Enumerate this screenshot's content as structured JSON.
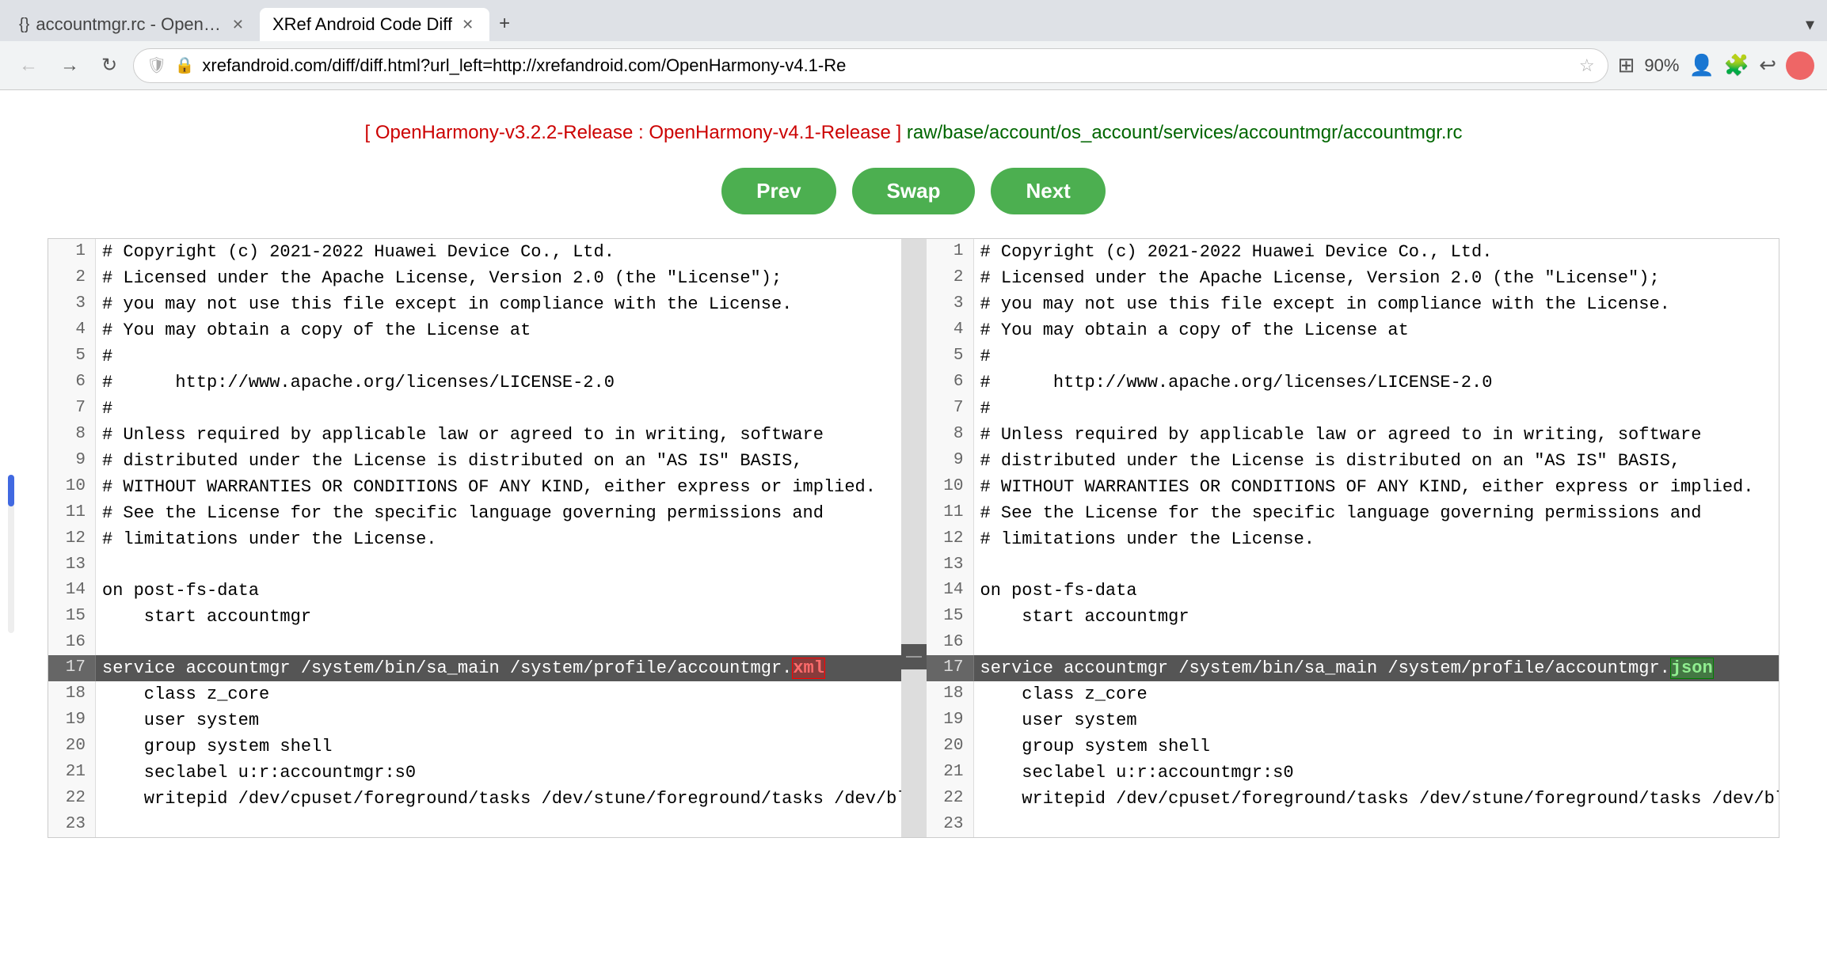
{
  "browser": {
    "tabs": [
      {
        "id": "tab1",
        "title": "accountmgr.rc - OpenGrok c",
        "icon": "{}",
        "active": false
      },
      {
        "id": "tab2",
        "title": "XRef Android Code Diff",
        "icon": "",
        "active": true
      }
    ],
    "new_tab_label": "+",
    "tab_dropdown": "▾",
    "nav": {
      "back": "←",
      "forward": "→",
      "refresh": "↻"
    },
    "url": "xrefandroid.com/diff/diff.html?url_left=http://xrefandroid.com/OpenHarmony-v4.1-Re",
    "url_full": "xrefandroid.com/diff/diff.html?url_left=http://xrefandroid.com/OpenHarmony-v4.1-Re",
    "zoom": "90%",
    "star_label": "☆",
    "actions": {
      "extensions": "⊞",
      "puzzle": "🧩",
      "history": "↩",
      "profile": "👤"
    }
  },
  "page": {
    "breadcrumb": {
      "left_version": "OpenHarmony-v3.2.2-Release",
      "separator": ":",
      "right_version": "OpenHarmony-v4.1-Release",
      "path": "raw/base/account/os_account/services/accountmgr/accountmgr.rc"
    },
    "buttons": {
      "prev": "Prev",
      "swap": "Swap",
      "next": "Next"
    }
  },
  "diff": {
    "left": {
      "lines": [
        {
          "num": 1,
          "content": "# Copyright (c) 2021-2022 Huawei Device Co., Ltd.",
          "highlight": false
        },
        {
          "num": 2,
          "content": "# Licensed under the Apache License, Version 2.0 (the \"License\");",
          "highlight": false
        },
        {
          "num": 3,
          "content": "# you may not use this file except in compliance with the License.",
          "highlight": false
        },
        {
          "num": 4,
          "content": "# You may obtain a copy of the License at",
          "highlight": false
        },
        {
          "num": 5,
          "content": "#",
          "highlight": false
        },
        {
          "num": 6,
          "content": "#      http://www.apache.org/licenses/LICENSE-2.0",
          "highlight": false
        },
        {
          "num": 7,
          "content": "#",
          "highlight": false
        },
        {
          "num": 8,
          "content": "# Unless required by applicable law or agreed to in writing, software",
          "highlight": false
        },
        {
          "num": 9,
          "content": "# distributed under the License is distributed on an \"AS IS\" BASIS,",
          "highlight": false
        },
        {
          "num": 10,
          "content": "# WITHOUT WARRANTIES OR CONDITIONS OF ANY KIND, either express or implied.",
          "highlight": false
        },
        {
          "num": 11,
          "content": "# See the License for the specific language governing permissions and",
          "highlight": false
        },
        {
          "num": 12,
          "content": "# limitations under the License.",
          "highlight": false
        },
        {
          "num": 13,
          "content": "",
          "highlight": false
        },
        {
          "num": 14,
          "content": "on post-fs-data",
          "highlight": false
        },
        {
          "num": 15,
          "content": "    start accountmgr",
          "highlight": false
        },
        {
          "num": 16,
          "content": "",
          "highlight": false
        },
        {
          "num": 17,
          "content_prefix": "service accountmgr /system/bin/sa_main /system/profile/accountmgr.",
          "diff_word": "xml",
          "diff_type": "removed",
          "highlight": true
        },
        {
          "num": 18,
          "content": "    class z_core",
          "highlight": false
        },
        {
          "num": 19,
          "content": "    user system",
          "highlight": false
        },
        {
          "num": 20,
          "content": "    group system shell",
          "highlight": false
        },
        {
          "num": 21,
          "content": "    seclabel u:r:accountmgr:s0",
          "highlight": false
        },
        {
          "num": 22,
          "content": "    writepid /dev/cpuset/foreground/tasks /dev/stune/foreground/tasks /dev/blkio/foreground/tasks /de",
          "highlight": false
        },
        {
          "num": 23,
          "content": "",
          "highlight": false
        }
      ]
    },
    "right": {
      "lines": [
        {
          "num": 1,
          "content": "# Copyright (c) 2021-2022 Huawei Device Co., Ltd.",
          "highlight": false
        },
        {
          "num": 2,
          "content": "# Licensed under the Apache License, Version 2.0 (the \"License\");",
          "highlight": false
        },
        {
          "num": 3,
          "content": "# you may not use this file except in compliance with the License.",
          "highlight": false
        },
        {
          "num": 4,
          "content": "# You may obtain a copy of the License at",
          "highlight": false
        },
        {
          "num": 5,
          "content": "#",
          "highlight": false
        },
        {
          "num": 6,
          "content": "#      http://www.apache.org/licenses/LICENSE-2.0",
          "highlight": false
        },
        {
          "num": 7,
          "content": "#",
          "highlight": false
        },
        {
          "num": 8,
          "content": "# Unless required by applicable law or agreed to in writing, software",
          "highlight": false
        },
        {
          "num": 9,
          "content": "# distributed under the License is distributed on an \"AS IS\" BASIS,",
          "highlight": false
        },
        {
          "num": 10,
          "content": "# WITHOUT WARRANTIES OR CONDITIONS OF ANY KIND, either express or implied.",
          "highlight": false
        },
        {
          "num": 11,
          "content": "# See the License for the specific language governing permissions and",
          "highlight": false
        },
        {
          "num": 12,
          "content": "# limitations under the License.",
          "highlight": false
        },
        {
          "num": 13,
          "content": "",
          "highlight": false
        },
        {
          "num": 14,
          "content": "on post-fs-data",
          "highlight": false
        },
        {
          "num": 15,
          "content": "    start accountmgr",
          "highlight": false
        },
        {
          "num": 16,
          "content": "",
          "highlight": false
        },
        {
          "num": 17,
          "content_prefix": "service accountmgr /system/bin/sa_main /system/profile/accountmgr.",
          "diff_word": "json",
          "diff_type": "added",
          "highlight": true
        },
        {
          "num": 18,
          "content": "    class z_core",
          "highlight": false
        },
        {
          "num": 19,
          "content": "    user system",
          "highlight": false
        },
        {
          "num": 20,
          "content": "    group system shell",
          "highlight": false
        },
        {
          "num": 21,
          "content": "    seclabel u:r:accountmgr:s0",
          "highlight": false
        },
        {
          "num": 22,
          "content": "    writepid /dev/cpuset/foreground/tasks /dev/stune/foreground/tasks /dev/blkio/foreground/tasks /de",
          "highlight": false
        },
        {
          "num": 23,
          "content": "",
          "highlight": false
        }
      ]
    }
  },
  "colors": {
    "tab_active_bg": "#ffffff",
    "tab_inactive_bg": "#dee1e6",
    "browser_bg": "#f1f3f4",
    "nav_button_green": "#4CAF50",
    "diff_highlight": "#555555",
    "diff_removed_color": "#ff0000",
    "diff_added_color": "#006600",
    "breadcrumb_red": "#cc0000",
    "breadcrumb_green": "#006600"
  }
}
